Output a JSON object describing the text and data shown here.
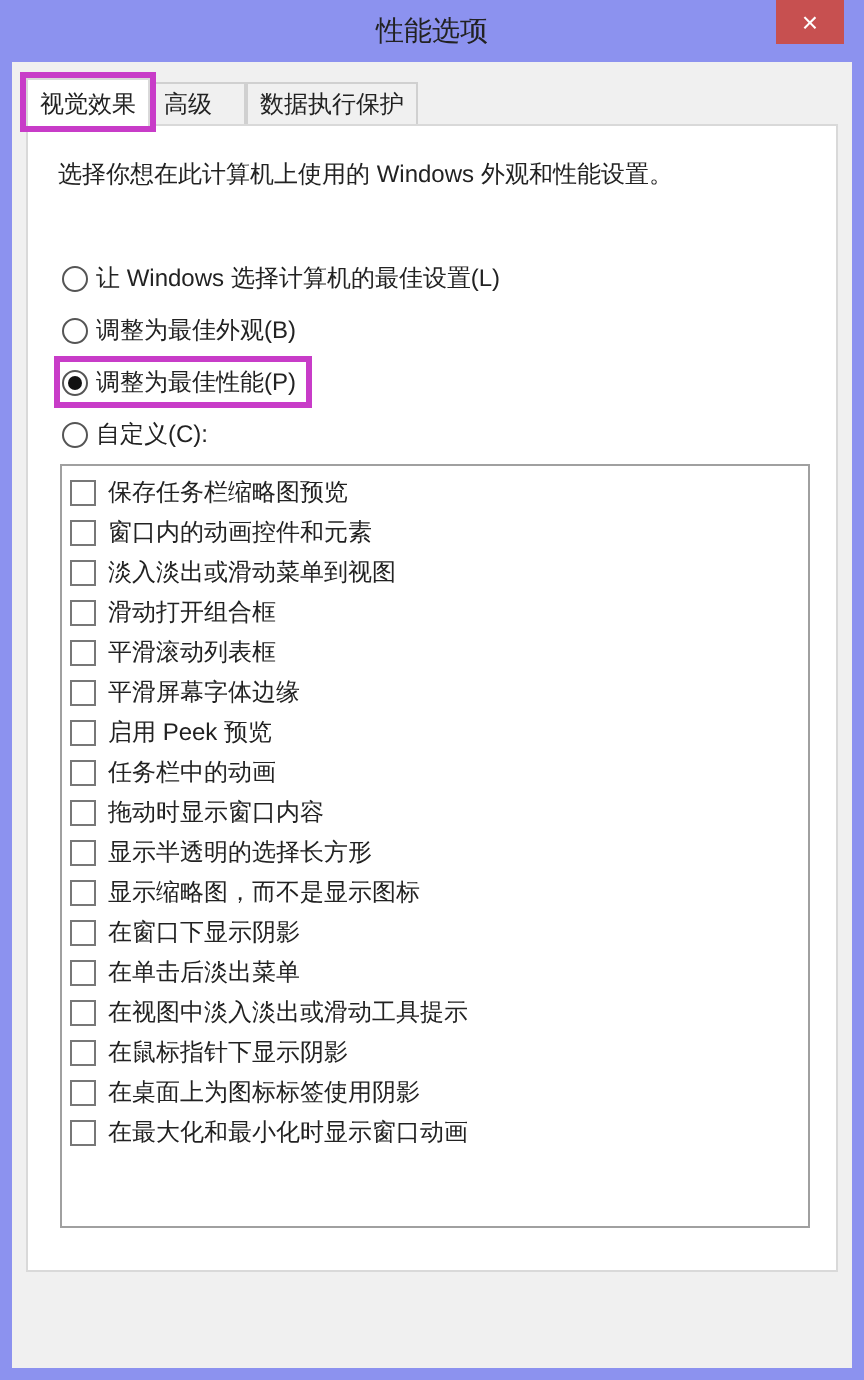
{
  "window": {
    "title": "性能选项",
    "close": "×"
  },
  "tabs": [
    {
      "label": "视觉效果",
      "selected": true,
      "highlighted": true
    },
    {
      "label": "高级",
      "selected": false,
      "highlighted": false
    },
    {
      "label": "数据执行保护",
      "selected": false,
      "highlighted": false
    }
  ],
  "description": "选择你想在此计算机上使用的 Windows 外观和性能设置。",
  "options": [
    {
      "label": "让 Windows 选择计算机的最佳设置(L)",
      "selected": false,
      "highlighted": false
    },
    {
      "label": "调整为最佳外观(B)",
      "selected": false,
      "highlighted": false
    },
    {
      "label": "调整为最佳性能(P)",
      "selected": true,
      "highlighted": true
    },
    {
      "label": "自定义(C):",
      "selected": false,
      "highlighted": false
    }
  ],
  "effects": [
    {
      "label": "保存任务栏缩略图预览",
      "checked": false
    },
    {
      "label": "窗口内的动画控件和元素",
      "checked": false
    },
    {
      "label": "淡入淡出或滑动菜单到视图",
      "checked": false
    },
    {
      "label": "滑动打开组合框",
      "checked": false
    },
    {
      "label": "平滑滚动列表框",
      "checked": false
    },
    {
      "label": "平滑屏幕字体边缘",
      "checked": false
    },
    {
      "label": "启用 Peek 预览",
      "checked": false
    },
    {
      "label": "任务栏中的动画",
      "checked": false
    },
    {
      "label": "拖动时显示窗口内容",
      "checked": false
    },
    {
      "label": "显示半透明的选择长方形",
      "checked": false
    },
    {
      "label": "显示缩略图，而不是显示图标",
      "checked": false
    },
    {
      "label": "在窗口下显示阴影",
      "checked": false
    },
    {
      "label": "在单击后淡出菜单",
      "checked": false
    },
    {
      "label": "在视图中淡入淡出或滑动工具提示",
      "checked": false
    },
    {
      "label": "在鼠标指针下显示阴影",
      "checked": false
    },
    {
      "label": "在桌面上为图标标签使用阴影",
      "checked": false
    },
    {
      "label": "在最大化和最小化时显示窗口动画",
      "checked": false
    }
  ]
}
